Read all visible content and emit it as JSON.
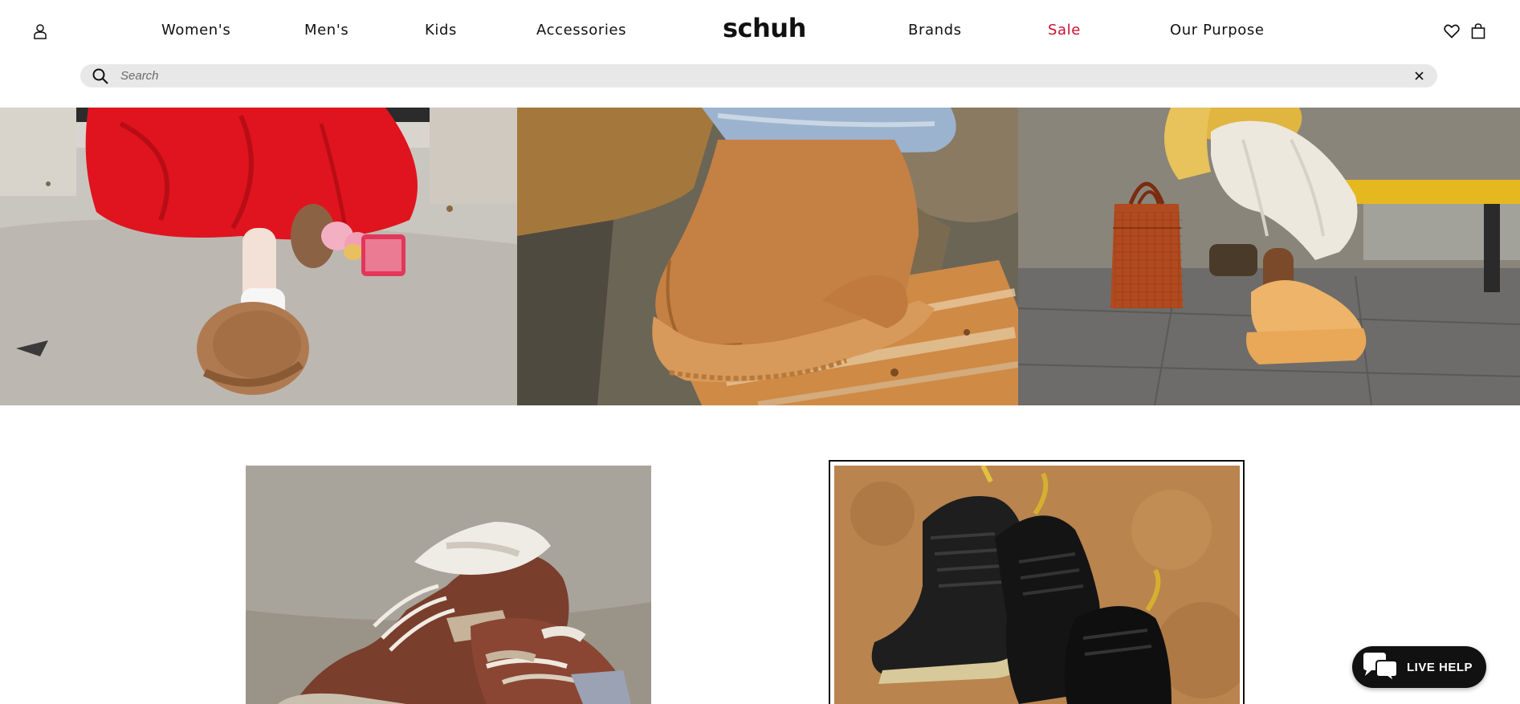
{
  "header": {
    "logo": "schuh",
    "nav": [
      {
        "label": "Women's"
      },
      {
        "label": "Men's"
      },
      {
        "label": "Kids"
      },
      {
        "label": "Accessories"
      },
      {
        "label": "Brands"
      },
      {
        "label": "Sale"
      },
      {
        "label": "Our Purpose"
      }
    ],
    "icons": {
      "account": "user-icon",
      "wishlist": "heart-icon",
      "bag": "shopping-bag-icon"
    },
    "sale_color": "#c8102e"
  },
  "search": {
    "placeholder": "Search",
    "value": "",
    "icon": "search-icon",
    "clear_icon": "close-icon",
    "background": "#e8e8e8"
  },
  "hero_panels": [
    {
      "name": "red-tulle-skirt-clog-slippers"
    },
    {
      "name": "tan-suede-platform-boot"
    },
    {
      "name": "yellow-platform-boot-orange-bag"
    }
  ],
  "promo_tiles": [
    {
      "name": "brown-retro-trainers"
    },
    {
      "name": "black-leather-lace-up-boots"
    }
  ],
  "live_help": {
    "label": "LIVE HELP",
    "icon": "chat-bubbles-icon",
    "background": "#111111"
  }
}
